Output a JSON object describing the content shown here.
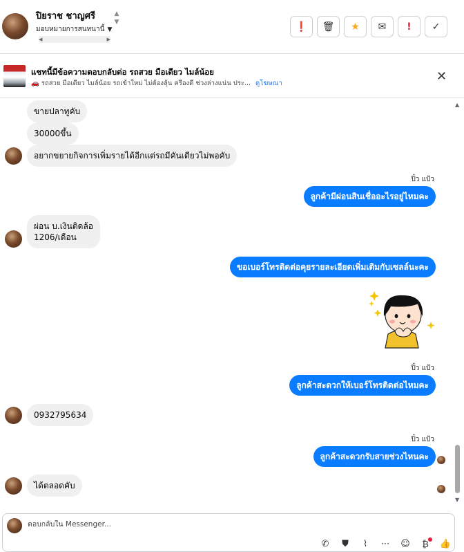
{
  "header": {
    "contact_name": "ปิยราช ชาญศรี",
    "assign_label": "มอบหมายการสนทนานี้",
    "actions": [
      {
        "name": "info-button",
        "icon": "alert-circle-icon",
        "glyph": "❗"
      },
      {
        "name": "delete-button",
        "icon": "trash-icon",
        "glyph": "🗑"
      },
      {
        "name": "star-button",
        "icon": "star-icon",
        "glyph": "★"
      },
      {
        "name": "mark-unread-button",
        "icon": "mail-icon",
        "glyph": "✉"
      },
      {
        "name": "spam-button",
        "icon": "exclamation-icon",
        "glyph": "!"
      },
      {
        "name": "mark-done-button",
        "icon": "check-icon",
        "glyph": "✓"
      }
    ]
  },
  "ad_context": {
    "title": "แชทนี้มีข้อความตอบกลับต่อ รถสวย มือเดียว ไมล์น้อย",
    "subtitle": "🚗 รถสวย มือเดียว ไมล์น้อย รถเข้าใหม่ ไม่ต้องลุ้น ครีองดี ช่วงล่างแน่น ประ...",
    "link": "ดูโฆษณา",
    "close_glyph": "✕"
  },
  "messages": {
    "m1": "ขายปลาทูคับ",
    "m2": "30000ขึ้น",
    "m3": "อยากขยายกิจการเพิ่มรายได้อีกแต่รถมีคันเดียวไม่พอคับ",
    "s1": "ปิ๋ว แป้ว",
    "m4": "ลูกค้ามีผ่อนสินเชื่ออะไรอยู่ไหมคะ",
    "m5a": "ผ่อน บ.เงินติดล้อ",
    "m5b": "1206/เดือน",
    "m6": "ขอเบอร์โทรติดต่อคุยรายละเอียดเพิ่มเติมกับเซลล์นะคะ",
    "s2": "ปิ๋ว แป้ว",
    "m7": "ลูกค้าสะดวกให้เบอร์โทรติดต่อไหมคะ",
    "m8": "0932795634",
    "s3": "ปิ๋ว แป้ว",
    "m9": "ลูกค้าสะดวกรับสายช่วงไหนคะ",
    "m10": "ได้ตลอดคับ"
  },
  "composer": {
    "placeholder": "ตอบกลับใน Messenger...",
    "tools": [
      "call-icon",
      "shopping-bag-icon",
      "paperclip-icon",
      "more-icon",
      "emoji-icon",
      "payment-icon",
      "like-icon"
    ]
  }
}
